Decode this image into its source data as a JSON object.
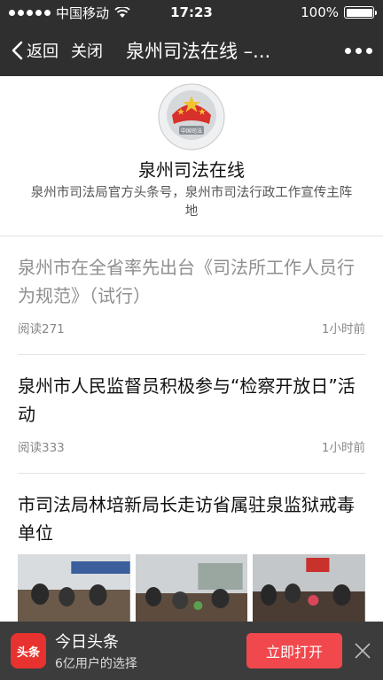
{
  "status": {
    "carrier": "中国移动",
    "time": "17:23",
    "battery": "100%"
  },
  "nav": {
    "back_label": "返回",
    "close_label": "关闭",
    "title": "泉州司法在线 –..."
  },
  "profile": {
    "name": "泉州司法在线",
    "description": "泉州市司法局官方头条号，泉州市司法行政工作宣传主阵地",
    "emblem_text": "中国司法"
  },
  "articles": [
    {
      "title": "泉州市在全省率先出台《司法所工作人员行为规范》（试行）",
      "reads": "阅读271",
      "time": "1小时前",
      "read_state": "read"
    },
    {
      "title": "泉州市人民监督员积极参与“检察开放日”活动",
      "reads": "阅读333",
      "time": "1小时前",
      "read_state": "unread"
    },
    {
      "title": "市司法局林培新局长走访省属驻泉监狱戒毒单位"
    }
  ],
  "banner": {
    "icon_text": "头条",
    "app_name": "今日头条",
    "subtitle": "6亿用户的选择",
    "open_label": "立即打开"
  },
  "colors": {
    "bar_bg": "#2f2f2f",
    "accent_red": "#f0484d",
    "app_icon_red": "#e8322f"
  }
}
